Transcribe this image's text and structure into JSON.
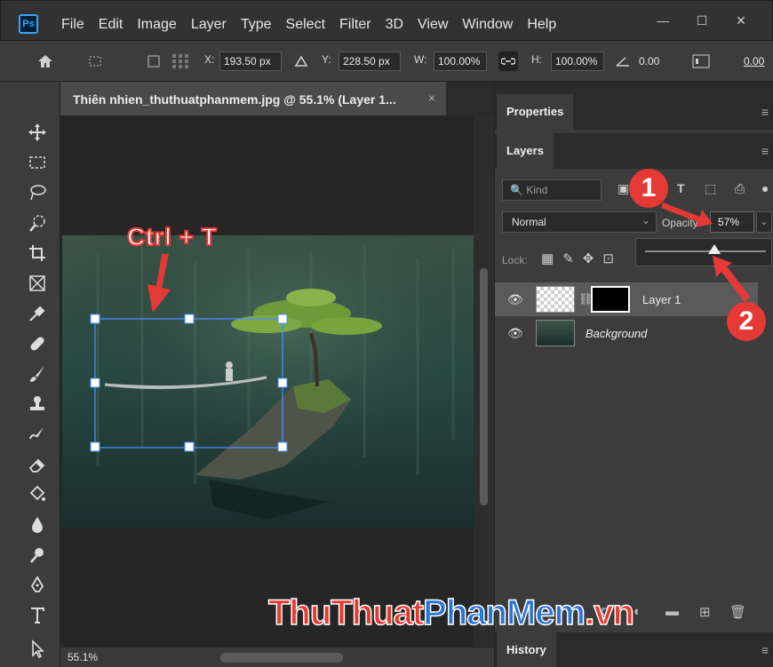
{
  "app": {
    "logo": "Ps"
  },
  "menu": [
    "File",
    "Edit",
    "Image",
    "Layer",
    "Type",
    "Select",
    "Filter",
    "3D",
    "View",
    "Window",
    "Help"
  ],
  "window_controls": {
    "minimize": "—",
    "maximize": "☐",
    "close": "✕"
  },
  "options_bar": {
    "x_label": "X:",
    "x_value": "193.50 px",
    "y_label": "Y:",
    "y_value": "228.50 px",
    "w_label": "W:",
    "w_value": "100.00%",
    "h_label": "H:",
    "h_value": "100.00%",
    "angle_value": "0.00",
    "skew_value": "0.00"
  },
  "document": {
    "tab_title": "Thiên nhien_thuthuatphanmem.jpg @ 55.1% (Layer 1...",
    "tab_close": "×",
    "zoom": "55.1%"
  },
  "annotation": {
    "shortcut": "Ctrl + T",
    "badge_1": "1",
    "badge_2": "2"
  },
  "panels": {
    "properties_tab": "Properties",
    "layers_tab": "Layers",
    "history_tab": "History",
    "menu_icon": "≡",
    "kind_placeholder": "🔍 Kind",
    "blend_mode": "Normal",
    "opacity_label": "Opacity:",
    "opacity_value": "57%",
    "opacity_fraction": 0.57,
    "lock_label": "Lock:",
    "layers": [
      {
        "name": "Layer 1",
        "selected": true,
        "italic": false
      },
      {
        "name": "Background",
        "selected": false,
        "italic": true
      }
    ]
  },
  "watermark": {
    "part1": "ThuThuat",
    "part2": "PhanMem",
    "part3": ".vn"
  },
  "colors": {
    "accent": "#31a8ff",
    "annotation_red": "#e53935",
    "selection_blue": "#4a8cff"
  }
}
